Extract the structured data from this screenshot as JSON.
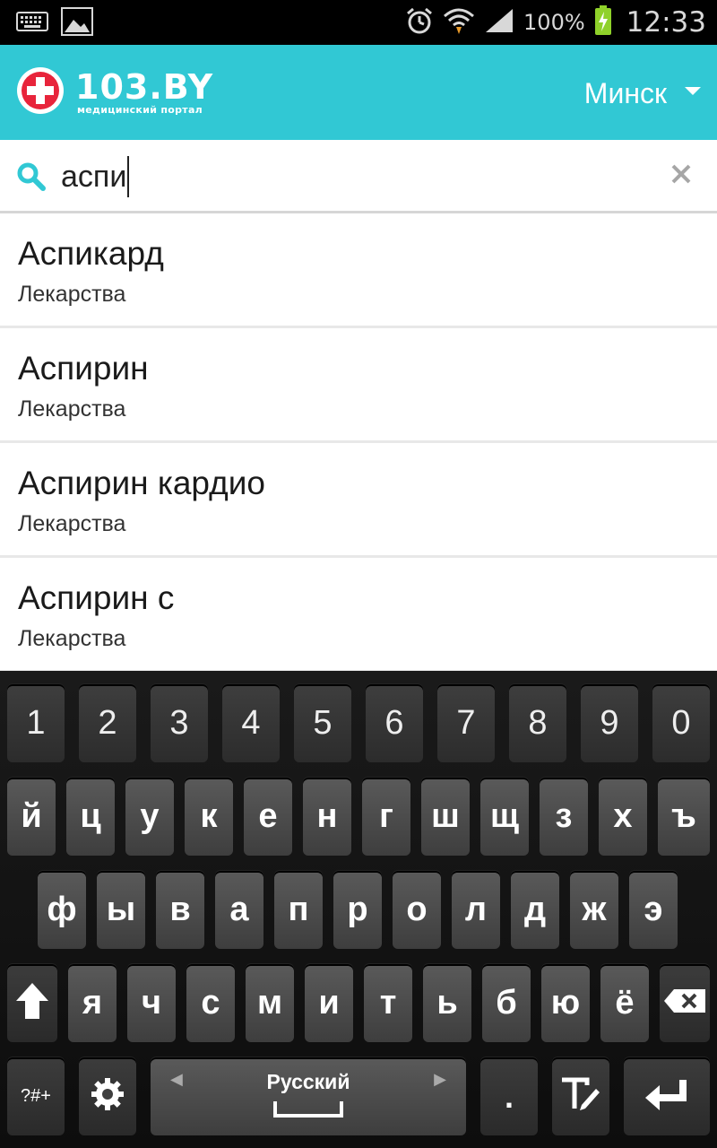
{
  "status_bar": {
    "battery_percent": "100%",
    "time": "12:33"
  },
  "header": {
    "logo_main": "103.BY",
    "logo_sub": "медицинский портал",
    "city": "Минск"
  },
  "search": {
    "query": "аспи"
  },
  "results": [
    {
      "title": "Аспикард",
      "category": "Лекарства"
    },
    {
      "title": "Аспирин",
      "category": "Лекарства"
    },
    {
      "title": "Аспирин кардио",
      "category": "Лекарства"
    },
    {
      "title": "Аспирин с",
      "category": "Лекарства"
    }
  ],
  "keyboard": {
    "number_row": [
      "1",
      "2",
      "3",
      "4",
      "5",
      "6",
      "7",
      "8",
      "9",
      "0"
    ],
    "row1": [
      "й",
      "ц",
      "у",
      "к",
      "е",
      "н",
      "г",
      "ш",
      "щ",
      "з",
      "х",
      "ъ"
    ],
    "row2": [
      "ф",
      "ы",
      "в",
      "а",
      "п",
      "р",
      "о",
      "л",
      "д",
      "ж",
      "э"
    ],
    "row3": [
      "я",
      "ч",
      "с",
      "м",
      "и",
      "т",
      "ь",
      "б",
      "ю",
      "ё"
    ],
    "symbols_label": "?#+",
    "language_label": "Русский",
    "period_label": "."
  }
}
